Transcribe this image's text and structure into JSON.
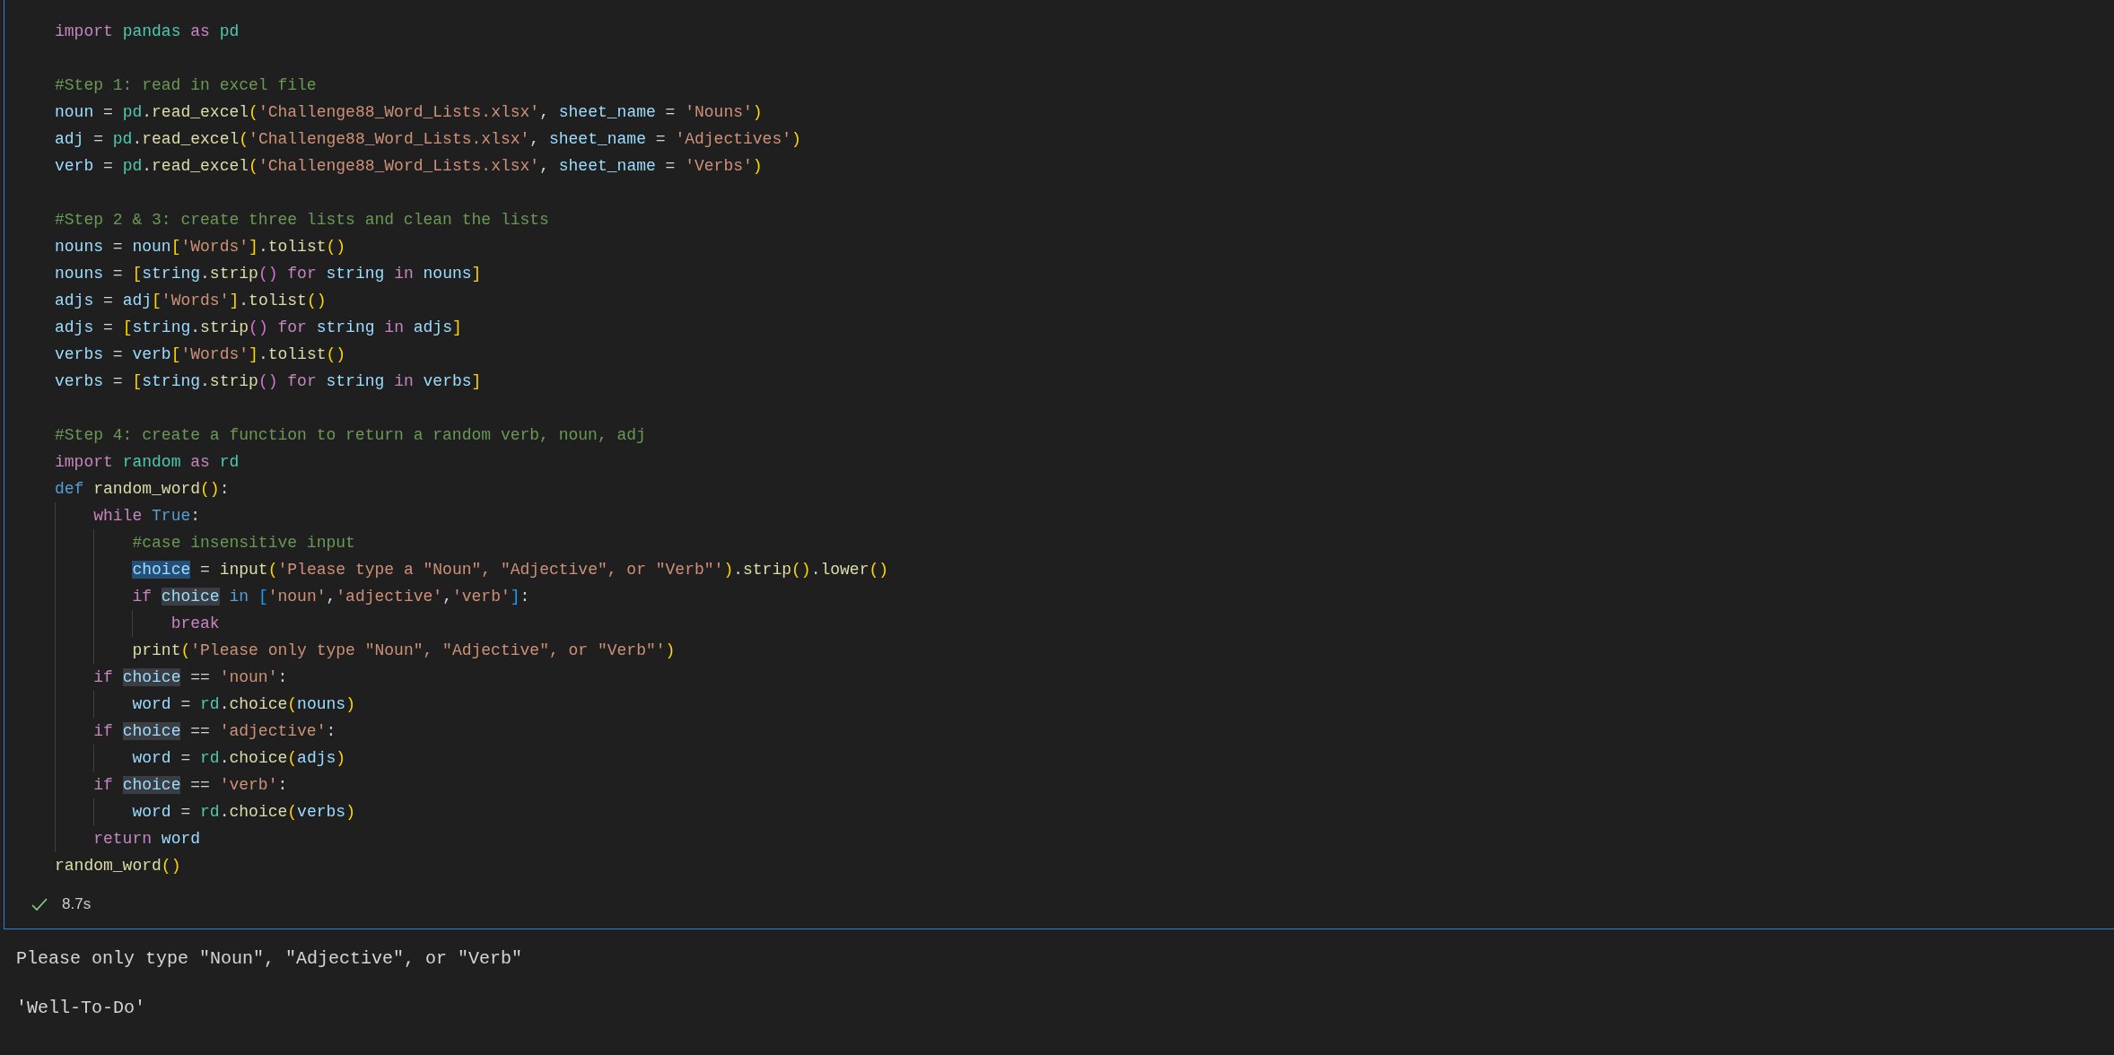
{
  "cell": {
    "blocks": [
      [
        [
          {
            "text": "import ",
            "kind": "kw"
          },
          {
            "text": "pandas ",
            "kind": "mod"
          },
          {
            "text": "as ",
            "kind": "kw"
          },
          {
            "text": "pd",
            "kind": "mod"
          }
        ]
      ],
      [
        [
          {
            "text": "#Step 1: read in excel file",
            "kind": "com"
          }
        ],
        [
          {
            "text": "noun",
            "kind": "var"
          },
          {
            "text": " = ",
            "kind": "p"
          },
          {
            "text": "pd",
            "kind": "mod"
          },
          {
            "text": ".",
            "kind": "p"
          },
          {
            "text": "read_excel",
            "kind": "fn"
          },
          {
            "text": "(",
            "kind": "b1"
          },
          {
            "text": "'Challenge88_Word_Lists.xlsx'",
            "kind": "str"
          },
          {
            "text": ", ",
            "kind": "p"
          },
          {
            "text": "sheet_name",
            "kind": "var"
          },
          {
            "text": " = ",
            "kind": "p"
          },
          {
            "text": "'Nouns'",
            "kind": "str"
          },
          {
            "text": ")",
            "kind": "b1"
          }
        ],
        [
          {
            "text": "adj",
            "kind": "var"
          },
          {
            "text": " = ",
            "kind": "p"
          },
          {
            "text": "pd",
            "kind": "mod"
          },
          {
            "text": ".",
            "kind": "p"
          },
          {
            "text": "read_excel",
            "kind": "fn"
          },
          {
            "text": "(",
            "kind": "b1"
          },
          {
            "text": "'Challenge88_Word_Lists.xlsx'",
            "kind": "str"
          },
          {
            "text": ", ",
            "kind": "p"
          },
          {
            "text": "sheet_name",
            "kind": "var"
          },
          {
            "text": " = ",
            "kind": "p"
          },
          {
            "text": "'Adjectives'",
            "kind": "str"
          },
          {
            "text": ")",
            "kind": "b1"
          }
        ],
        [
          {
            "text": "verb",
            "kind": "var"
          },
          {
            "text": " = ",
            "kind": "p"
          },
          {
            "text": "pd",
            "kind": "mod"
          },
          {
            "text": ".",
            "kind": "p"
          },
          {
            "text": "read_excel",
            "kind": "fn"
          },
          {
            "text": "(",
            "kind": "b1"
          },
          {
            "text": "'Challenge88_Word_Lists.xlsx'",
            "kind": "str"
          },
          {
            "text": ", ",
            "kind": "p"
          },
          {
            "text": "sheet_name",
            "kind": "var"
          },
          {
            "text": " = ",
            "kind": "p"
          },
          {
            "text": "'Verbs'",
            "kind": "str"
          },
          {
            "text": ")",
            "kind": "b1"
          }
        ]
      ],
      [
        [
          {
            "text": "#Step 2 & 3: create three lists and clean the lists",
            "kind": "com"
          }
        ],
        [
          {
            "text": "nouns",
            "kind": "var"
          },
          {
            "text": " = ",
            "kind": "p"
          },
          {
            "text": "noun",
            "kind": "var"
          },
          {
            "text": "[",
            "kind": "b1"
          },
          {
            "text": "'Words'",
            "kind": "str"
          },
          {
            "text": "]",
            "kind": "b1"
          },
          {
            "text": ".",
            "kind": "p"
          },
          {
            "text": "tolist",
            "kind": "fn"
          },
          {
            "text": "()",
            "kind": "b1"
          }
        ],
        [
          {
            "text": "nouns",
            "kind": "var"
          },
          {
            "text": " = ",
            "kind": "p"
          },
          {
            "text": "[",
            "kind": "b1"
          },
          {
            "text": "string",
            "kind": "var"
          },
          {
            "text": ".",
            "kind": "p"
          },
          {
            "text": "strip",
            "kind": "fn"
          },
          {
            "text": "() ",
            "kind": "b2"
          },
          {
            "text": "for ",
            "kind": "kw"
          },
          {
            "text": "string ",
            "kind": "var"
          },
          {
            "text": "in ",
            "kind": "kw"
          },
          {
            "text": "nouns",
            "kind": "var"
          },
          {
            "text": "]",
            "kind": "b1"
          }
        ],
        [
          {
            "text": "adjs",
            "kind": "var"
          },
          {
            "text": " = ",
            "kind": "p"
          },
          {
            "text": "adj",
            "kind": "var"
          },
          {
            "text": "[",
            "kind": "b1"
          },
          {
            "text": "'Words'",
            "kind": "str"
          },
          {
            "text": "]",
            "kind": "b1"
          },
          {
            "text": ".",
            "kind": "p"
          },
          {
            "text": "tolist",
            "kind": "fn"
          },
          {
            "text": "()",
            "kind": "b1"
          }
        ],
        [
          {
            "text": "adjs",
            "kind": "var"
          },
          {
            "text": " = ",
            "kind": "p"
          },
          {
            "text": "[",
            "kind": "b1"
          },
          {
            "text": "string",
            "kind": "var"
          },
          {
            "text": ".",
            "kind": "p"
          },
          {
            "text": "strip",
            "kind": "fn"
          },
          {
            "text": "() ",
            "kind": "b2"
          },
          {
            "text": "for ",
            "kind": "kw"
          },
          {
            "text": "string ",
            "kind": "var"
          },
          {
            "text": "in ",
            "kind": "kw"
          },
          {
            "text": "adjs",
            "kind": "var"
          },
          {
            "text": "]",
            "kind": "b1"
          }
        ],
        [
          {
            "text": "verbs",
            "kind": "var"
          },
          {
            "text": " = ",
            "kind": "p"
          },
          {
            "text": "verb",
            "kind": "var"
          },
          {
            "text": "[",
            "kind": "b1"
          },
          {
            "text": "'Words'",
            "kind": "str"
          },
          {
            "text": "]",
            "kind": "b1"
          },
          {
            "text": ".",
            "kind": "p"
          },
          {
            "text": "tolist",
            "kind": "fn"
          },
          {
            "text": "()",
            "kind": "b1"
          }
        ],
        [
          {
            "text": "verbs",
            "kind": "var"
          },
          {
            "text": " = ",
            "kind": "p"
          },
          {
            "text": "[",
            "kind": "b1"
          },
          {
            "text": "string",
            "kind": "var"
          },
          {
            "text": ".",
            "kind": "p"
          },
          {
            "text": "strip",
            "kind": "fn"
          },
          {
            "text": "() ",
            "kind": "b2"
          },
          {
            "text": "for ",
            "kind": "kw"
          },
          {
            "text": "string ",
            "kind": "var"
          },
          {
            "text": "in ",
            "kind": "kw"
          },
          {
            "text": "verbs",
            "kind": "var"
          },
          {
            "text": "]",
            "kind": "b1"
          }
        ]
      ],
      [
        [
          {
            "text": "#Step 4: create a function to return a random verb, noun, adj",
            "kind": "com"
          }
        ],
        [
          {
            "text": "import ",
            "kind": "kw"
          },
          {
            "text": "random ",
            "kind": "mod"
          },
          {
            "text": "as ",
            "kind": "kw"
          },
          {
            "text": "rd",
            "kind": "mod"
          }
        ],
        [
          {
            "text": "def ",
            "kind": "st"
          },
          {
            "text": "random_word",
            "kind": "fn"
          },
          {
            "text": "()",
            "kind": "b1"
          },
          {
            "text": ":",
            "kind": "p"
          }
        ],
        [
          {
            "text": "    while ",
            "kind": "kw"
          },
          {
            "text": "True",
            "kind": "st"
          },
          {
            "text": ":",
            "kind": "p"
          }
        ],
        [
          {
            "text": "        #case insensitive input",
            "kind": "com"
          }
        ],
        [
          {
            "text": "        choice",
            "kind": "selvar"
          },
          {
            "text": " = ",
            "kind": "p"
          },
          {
            "text": "input",
            "kind": "fn"
          },
          {
            "text": "(",
            "kind": "b1"
          },
          {
            "text": "'Please type a \"Noun\", \"Adjective\", or \"Verb\"'",
            "kind": "str"
          },
          {
            "text": ")",
            "kind": "b1"
          },
          {
            "text": ".",
            "kind": "p"
          },
          {
            "text": "strip",
            "kind": "fn"
          },
          {
            "text": "()",
            "kind": "b1"
          },
          {
            "text": ".",
            "kind": "p"
          },
          {
            "text": "lower",
            "kind": "fn"
          },
          {
            "text": "()",
            "kind": "b1"
          }
        ],
        [
          {
            "text": "        if ",
            "kind": "kw"
          },
          {
            "text": "choice",
            "kind": "occvar"
          },
          {
            "text": " in ",
            "kind": "st"
          },
          {
            "text": "[",
            "kind": "b3"
          },
          {
            "text": "'noun'",
            "kind": "str"
          },
          {
            "text": ",",
            "kind": "p"
          },
          {
            "text": "'adjective'",
            "kind": "str"
          },
          {
            "text": ",",
            "kind": "p"
          },
          {
            "text": "'verb'",
            "kind": "str"
          },
          {
            "text": "]",
            "kind": "b3"
          },
          {
            "text": ":",
            "kind": "p"
          }
        ],
        [
          {
            "text": "            break",
            "kind": "kw"
          }
        ],
        [
          {
            "text": "        print",
            "kind": "fn"
          },
          {
            "text": "(",
            "kind": "b1"
          },
          {
            "text": "'Please only type \"Noun\", \"Adjective\", or \"Verb\"'",
            "kind": "str"
          },
          {
            "text": ")",
            "kind": "b1"
          }
        ],
        [
          {
            "text": "    if ",
            "kind": "kw"
          },
          {
            "text": "choice",
            "kind": "occvar"
          },
          {
            "text": " == ",
            "kind": "p"
          },
          {
            "text": "'noun'",
            "kind": "str"
          },
          {
            "text": ":",
            "kind": "p"
          }
        ],
        [
          {
            "text": "        word",
            "kind": "var"
          },
          {
            "text": " = ",
            "kind": "p"
          },
          {
            "text": "rd",
            "kind": "mod"
          },
          {
            "text": ".",
            "kind": "p"
          },
          {
            "text": "choice",
            "kind": "fn"
          },
          {
            "text": "(",
            "kind": "b1"
          },
          {
            "text": "nouns",
            "kind": "var"
          },
          {
            "text": ")",
            "kind": "b1"
          }
        ],
        [
          {
            "text": "    if ",
            "kind": "kw"
          },
          {
            "text": "choice",
            "kind": "occvar"
          },
          {
            "text": " == ",
            "kind": "p"
          },
          {
            "text": "'adjective'",
            "kind": "str"
          },
          {
            "text": ":",
            "kind": "p"
          }
        ],
        [
          {
            "text": "        word",
            "kind": "var"
          },
          {
            "text": " = ",
            "kind": "p"
          },
          {
            "text": "rd",
            "kind": "mod"
          },
          {
            "text": ".",
            "kind": "p"
          },
          {
            "text": "choice",
            "kind": "fn"
          },
          {
            "text": "(",
            "kind": "b1"
          },
          {
            "text": "adjs",
            "kind": "var"
          },
          {
            "text": ")",
            "kind": "b1"
          }
        ],
        [
          {
            "text": "    if ",
            "kind": "kw"
          },
          {
            "text": "choice",
            "kind": "occvar"
          },
          {
            "text": " == ",
            "kind": "p"
          },
          {
            "text": "'verb'",
            "kind": "str"
          },
          {
            "text": ":",
            "kind": "p"
          }
        ],
        [
          {
            "text": "        word",
            "kind": "var"
          },
          {
            "text": " = ",
            "kind": "p"
          },
          {
            "text": "rd",
            "kind": "mod"
          },
          {
            "text": ".",
            "kind": "p"
          },
          {
            "text": "choice",
            "kind": "fn"
          },
          {
            "text": "(",
            "kind": "b1"
          },
          {
            "text": "verbs",
            "kind": "var"
          },
          {
            "text": ")",
            "kind": "b1"
          }
        ],
        [
          {
            "text": "    return ",
            "kind": "kw"
          },
          {
            "text": "word",
            "kind": "var"
          }
        ],
        [
          {
            "text": "random_word",
            "kind": "fn"
          },
          {
            "text": "()",
            "kind": "b1"
          }
        ]
      ]
    ],
    "status": {
      "succeeded": true,
      "duration": "8.7s"
    }
  },
  "output": {
    "lines": [
      "Please only type \"Noun\", \"Adjective\", or \"Verb\"",
      "'Well-To-Do'"
    ]
  }
}
